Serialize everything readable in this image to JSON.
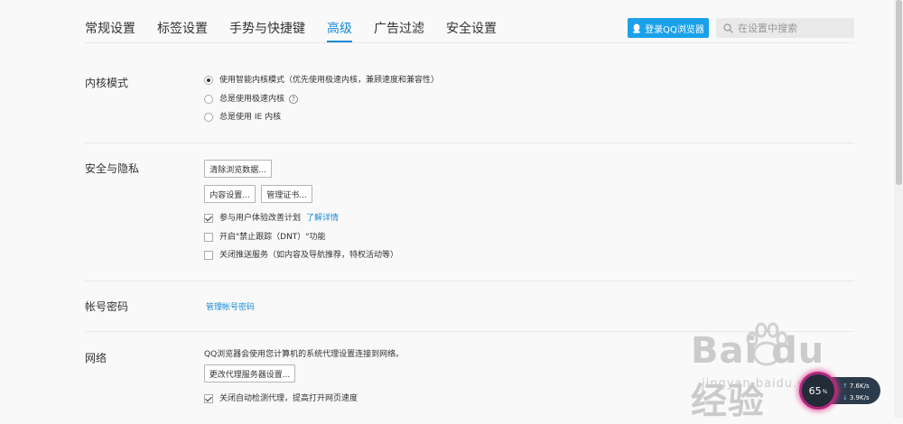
{
  "tabs": [
    {
      "label": "常规设置",
      "active": false
    },
    {
      "label": "标签设置",
      "active": false
    },
    {
      "label": "手势与快捷键",
      "active": false
    },
    {
      "label": "高级",
      "active": true
    },
    {
      "label": "广告过滤",
      "active": false
    },
    {
      "label": "安全设置",
      "active": false
    }
  ],
  "header": {
    "login_label": "登录QQ浏览器",
    "search_placeholder": "在设置中搜索"
  },
  "kernel": {
    "title": "内核模式",
    "options": [
      {
        "label": "使用智能内核模式（优先使用极速内核，兼顾速度和兼容性）",
        "checked": true
      },
      {
        "label": "总是使用极速内核",
        "checked": false
      },
      {
        "label": "总是使用 IE 内核",
        "checked": false
      }
    ],
    "help_glyph": "?"
  },
  "privacy": {
    "title": "安全与隐私",
    "clear_button": "清除浏览数据...",
    "content_button": "内容设置...",
    "cert_button": "管理证书...",
    "checks": [
      {
        "label": "参与用户体验改善计划",
        "checked": true,
        "link": "了解详情"
      },
      {
        "label": "开启\"禁止跟踪（DNT）\"功能",
        "checked": false
      },
      {
        "label": "关闭推送服务（如内容及导航推荐，特权活动等）",
        "checked": false
      }
    ]
  },
  "account": {
    "title": "帐号密码",
    "link": "管理帐号密码"
  },
  "network": {
    "title": "网络",
    "description": "QQ浏览器会使用您计算机的系统代理设置连接到网络。",
    "proxy_button": "更改代理服务器设置...",
    "check_label": "关闭自动检测代理，提高打开网页速度",
    "checked": true
  },
  "watermark": {
    "main": "Bai du 经验",
    "sub": "jingyan.baidu.com"
  },
  "speed_widget": {
    "percent": "65",
    "percent_sign": "%",
    "up": "7.6K/s",
    "down": "3.9K/s"
  },
  "colors": {
    "accent": "#1a8cd8",
    "login_bg": "#1aa1ea",
    "widget_ring": "#b3287d"
  }
}
